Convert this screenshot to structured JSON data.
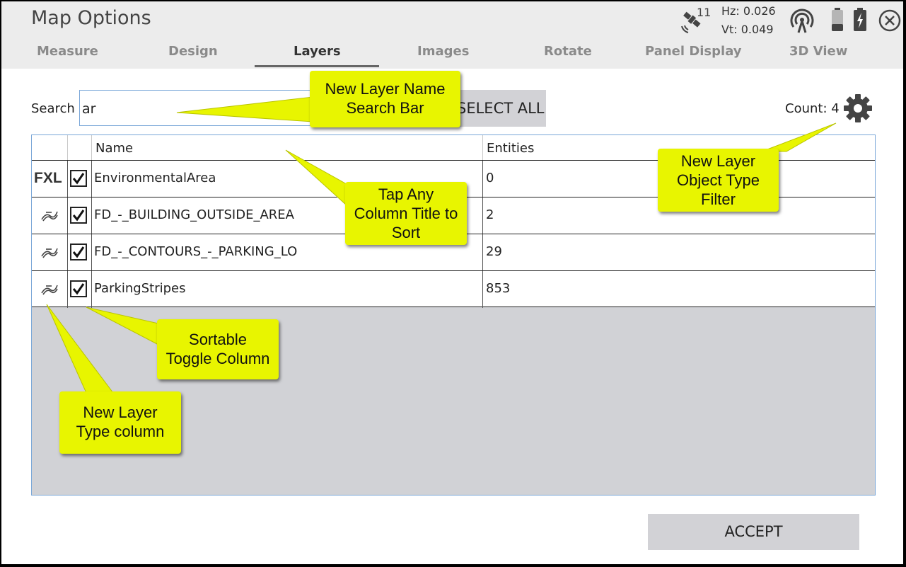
{
  "header": {
    "title": "Map Options",
    "tabs": [
      {
        "label": "Measure"
      },
      {
        "label": "Design"
      },
      {
        "label": "Layers"
      },
      {
        "label": "Images"
      },
      {
        "label": "Rotate"
      },
      {
        "label": "Panel Display"
      },
      {
        "label": "3D View"
      }
    ],
    "active_tab": "Layers",
    "status": {
      "satellite_count": "11",
      "hz": "Hz: 0.026",
      "vt": "Vt: 0.049",
      "icons": [
        "satellite-icon",
        "radio-signal-icon",
        "battery-low-icon",
        "battery-charging-icon",
        "close-icon"
      ]
    }
  },
  "search": {
    "label": "Search",
    "value": "ar",
    "select_all_label": "SELECT ALL"
  },
  "count_label": "Count: 4",
  "filter_icon": "gear-icon",
  "table": {
    "columns": [
      "",
      "",
      "Name",
      "Entities"
    ],
    "rows": [
      {
        "type": "FXL",
        "checked": true,
        "name": "EnvironmentalArea",
        "entities": "0"
      },
      {
        "type": "linework-icon",
        "checked": true,
        "name": "FD_-_BUILDING_OUTSIDE_AREA",
        "entities": "2"
      },
      {
        "type": "linework-icon",
        "checked": true,
        "name": "FD_-_CONTOURS_-_PARKING_LO",
        "entities": "29"
      },
      {
        "type": "linework-icon",
        "checked": true,
        "name": "ParkingStripes",
        "entities": "853"
      }
    ]
  },
  "accept_label": "ACCEPT",
  "callouts": {
    "search_bar": [
      "New Layer Name",
      "Search Bar"
    ],
    "column_sort": [
      "Tap Any",
      "Column Title to",
      "Sort"
    ],
    "object_filter": [
      "New Layer",
      "Object Type",
      "Filter"
    ],
    "toggle_column": [
      "Sortable",
      "Toggle Column"
    ],
    "type_column": [
      "New Layer",
      "Type column"
    ]
  },
  "colors": {
    "callout": "#e8f500",
    "header_bg": "#ececec",
    "table_empty_bg": "#d1d2d6",
    "button_bg": "#d2d2d6",
    "input_border": "#7aa7d8"
  }
}
